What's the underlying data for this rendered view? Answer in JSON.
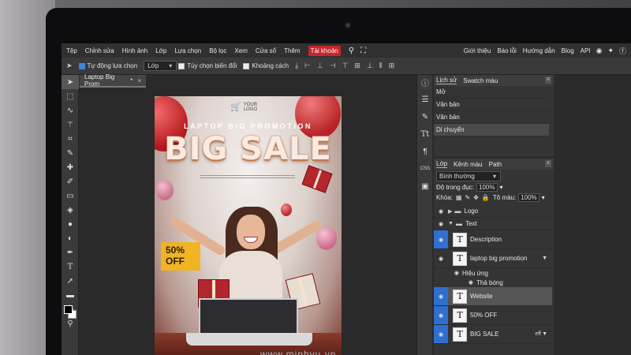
{
  "menubar": {
    "items": [
      "Tệp",
      "Chỉnh sửa",
      "Hình ảnh",
      "Lớp",
      "Lựa chọn",
      "Bộ lọc",
      "Xem",
      "Cửa sổ",
      "Thêm",
      "Tài khoản"
    ],
    "active_index": 9,
    "right_links": [
      "Giới thiệu",
      "Báo lỗi",
      "Hướng dẫn",
      "Blog",
      "API"
    ]
  },
  "options": {
    "auto_select_label": "Tự động lựa chọn",
    "auto_select_checked": true,
    "layer_select_value": "Lớp",
    "transform_label": "Tùy chọn biến đổi",
    "distance_label": "Khoảng cách"
  },
  "document": {
    "tab_title": "Laptop Big Prom",
    "tab_modified": "*",
    "close_glyph": "×"
  },
  "poster": {
    "logo_line1": "YOUR",
    "logo_line2": "LOGO",
    "promo": "LAPTOP BIG PROMOTION",
    "headline": "BIG SALE",
    "discount_line1": "50%",
    "discount_line2": "OFF",
    "bottom_site": "www.minhvu.vn"
  },
  "history": {
    "tabs": [
      "Lịch sử",
      "Swatch màu"
    ],
    "items": [
      "Mở",
      "Văn bản",
      "Văn bản",
      "Di chuyển"
    ],
    "current_index": 3
  },
  "layers": {
    "tabs": [
      "Lớp",
      "Kênh màu",
      "Path"
    ],
    "blend_mode": "Bình thường",
    "opacity_label": "Độ trong đục:",
    "opacity_value": "100%",
    "lock_label": "Khóa:",
    "fill_label": "Tô màu:",
    "fill_value": "100%",
    "rows": [
      {
        "name": "Logo",
        "kind": "group"
      },
      {
        "name": "Text",
        "kind": "group"
      },
      {
        "name": "Description",
        "kind": "text"
      },
      {
        "name": "laptop big promotion",
        "kind": "text"
      },
      {
        "name": "Hiệu ứng",
        "kind": "effect"
      },
      {
        "name": "Thả bóng",
        "kind": "effect"
      },
      {
        "name": "Website",
        "kind": "text"
      },
      {
        "name": "50% OFF",
        "kind": "text"
      },
      {
        "name": "BIG SALE",
        "kind": "text"
      }
    ],
    "fx_label": "eff"
  },
  "colors": {
    "active_menu": "#c9252b",
    "selection_blue": "#2f6fd0",
    "discount_badge": "#f0b424"
  }
}
